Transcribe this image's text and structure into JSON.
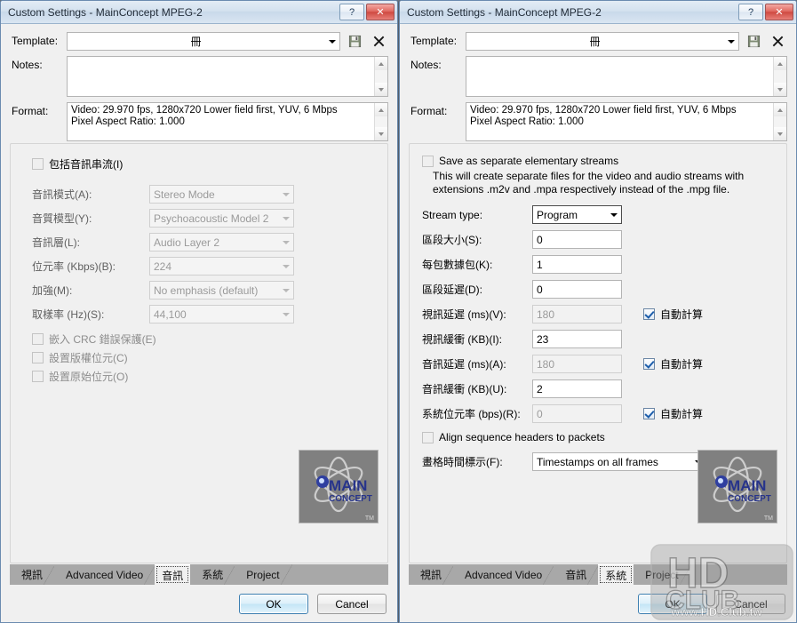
{
  "window_left": {
    "title": "Custom Settings - MainConcept MPEG-2",
    "help_label": "?",
    "close_label": "✕",
    "header": {
      "template_label": "Template:",
      "template_value": "冊",
      "save_icon": "floppy-save-icon",
      "delete_icon": "delete-x-icon",
      "notes_label": "Notes:",
      "notes_value": "",
      "format_label": "Format:",
      "format_value": "Video: 29.970 fps, 1280x720 Lower field first, YUV, 6 Mbps\nPixel Aspect Ratio: 1.000"
    },
    "audio_tab": {
      "include_audio_checkbox": "包括音訊串流(I)",
      "include_audio_checked": false,
      "fields": [
        {
          "label": "音訊模式(A):",
          "value": "Stereo Mode",
          "type": "combo",
          "disabled": true
        },
        {
          "label": "音質模型(Y):",
          "value": "Psychoacoustic Model 2",
          "type": "combo",
          "disabled": true
        },
        {
          "label": "音訊層(L):",
          "value": "Audio Layer 2",
          "type": "combo",
          "disabled": true
        },
        {
          "label": "位元率 (Kbps)(B):",
          "value": "224",
          "type": "combo",
          "disabled": true
        },
        {
          "label": "加強(M):",
          "value": "No emphasis (default)",
          "type": "combo",
          "disabled": true
        },
        {
          "label": "取樣率 (Hz)(S):",
          "value": "44,100",
          "type": "combo",
          "disabled": true
        }
      ],
      "checkboxes": [
        {
          "label": "嵌入 CRC 錯誤保護(E)",
          "checked": false,
          "disabled": true
        },
        {
          "label": "設置版權位元(C)",
          "checked": false,
          "disabled": true
        },
        {
          "label": "設置原始位元(O)",
          "checked": false,
          "disabled": true
        }
      ]
    },
    "tabs": [
      {
        "label": "視訊",
        "active": false
      },
      {
        "label": "Advanced Video",
        "active": false
      },
      {
        "label": "音訊",
        "active": true
      },
      {
        "label": "系統",
        "active": false
      },
      {
        "label": "Project",
        "active": false
      }
    ],
    "buttons": {
      "ok": "OK",
      "cancel": "Cancel"
    }
  },
  "window_right": {
    "title": "Custom Settings - MainConcept MPEG-2",
    "help_label": "?",
    "close_label": "✕",
    "header": {
      "template_label": "Template:",
      "template_value": "冊",
      "save_icon": "floppy-save-icon",
      "delete_icon": "delete-x-icon",
      "notes_label": "Notes:",
      "notes_value": "",
      "format_label": "Format:",
      "format_value": "Video: 29.970 fps, 1280x720 Lower field first, YUV, 6 Mbps\nPixel Aspect Ratio: 1.000"
    },
    "system_tab": {
      "save_separate_checkbox": "Save as separate elementary streams",
      "save_separate_checked": false,
      "description": "This will create separate files for the video and audio streams with extensions .m2v and .mpa respectively instead of the .mpg file.",
      "stream_type_label": "Stream type:",
      "stream_type_value": "Program",
      "fields": [
        {
          "label": "區段大小(S):",
          "value": "0",
          "disabled": false,
          "auto": null
        },
        {
          "label": "每包數據包(K):",
          "value": "1",
          "disabled": false,
          "auto": null
        },
        {
          "label": "區段延遲(D):",
          "value": "0",
          "disabled": false,
          "auto": null
        },
        {
          "label": "視訊延遲 (ms)(V):",
          "value": "180",
          "disabled": true,
          "auto": "自動計算"
        },
        {
          "label": "視訊緩衝 (KB)(I):",
          "value": "23",
          "disabled": false,
          "auto": null
        },
        {
          "label": "音訊延遲 (ms)(A):",
          "value": "180",
          "disabled": true,
          "auto": "自動計算"
        },
        {
          "label": "音訊緩衝 (KB)(U):",
          "value": "2",
          "disabled": false,
          "auto": null
        },
        {
          "label": "系統位元率 (bps)(R):",
          "value": "0",
          "disabled": true,
          "auto": "自動計算"
        }
      ],
      "align_checkbox": "Align sequence headers to packets",
      "align_checked": false,
      "timestamp_label": "畫格時間標示(F):",
      "timestamp_value": "Timestamps on all frames"
    },
    "tabs": [
      {
        "label": "視訊",
        "active": false
      },
      {
        "label": "Advanced Video",
        "active": false
      },
      {
        "label": "音訊",
        "active": false
      },
      {
        "label": "系統",
        "active": true
      },
      {
        "label": "Project",
        "active": false
      }
    ],
    "buttons": {
      "ok": "OK",
      "cancel": "Cancel"
    }
  },
  "logo": {
    "line1": "MAIN",
    "line2": "CONCEPT",
    "tm": "TM",
    "name": "mainconcept-logo"
  },
  "watermark": {
    "line1": "HD",
    "line2": "CLUB",
    "line3": "www.HD.Club.tw"
  },
  "colors": {
    "desktop": "#6f7d8c",
    "titlebar": "#d4e1ef",
    "window_bg": "#f0f0f0",
    "tabstrip": "#a8a8a8",
    "close_red": "#cf4a42",
    "accent_blue": "#3c7fb1",
    "logo_bg": "#808080",
    "logo_text": "#27348b"
  }
}
